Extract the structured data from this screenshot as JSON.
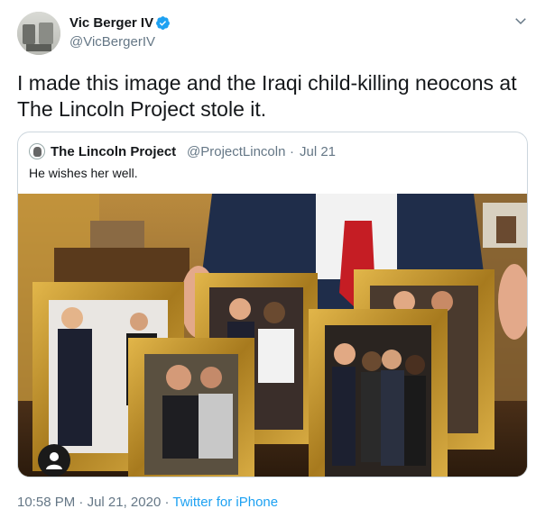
{
  "author": {
    "name": "Vic Berger IV",
    "handle": "@VicBergerIV",
    "verified": true
  },
  "tweet": {
    "text": "I made this image and the Iraqi child-killing neocons at The Lincoln Project stole it."
  },
  "quoted": {
    "name": "The Lincoln Project",
    "handle": "@ProjectLincoln",
    "separator": "·",
    "date": "Jul 21",
    "text": "He wishes her well."
  },
  "footer": {
    "time": "10:58 PM",
    "separator": "·",
    "date": "Jul 21, 2020",
    "separator2": "·",
    "source": "Twitter for iPhone"
  },
  "colors": {
    "link": "#1da1f2",
    "secondary_text": "#657786",
    "border": "#ccd6dd",
    "verified": "#1da1f2"
  },
  "icons": {
    "verified": "verified-badge-icon",
    "caret": "chevron-down-icon",
    "media": "person-icon"
  }
}
